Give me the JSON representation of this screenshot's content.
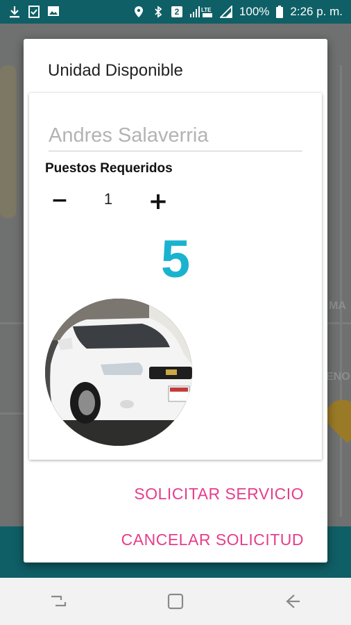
{
  "status_bar": {
    "battery": "100%",
    "time": "2:26 p. m.",
    "sim_slot": "2",
    "network": "LTE",
    "icons": [
      "download-icon",
      "checklist-icon",
      "image-icon",
      "location-icon",
      "bluetooth-icon",
      "sim-icon",
      "signal-icon",
      "battery-icon"
    ]
  },
  "map": {
    "labels": [
      "MA",
      "ENO"
    ]
  },
  "dialog": {
    "title": "Unidad Disponible",
    "driver_name": "Andres Salaverria",
    "seats_label": "Puestos Requeridos",
    "seats_value": "1",
    "minus_symbol": "−",
    "plus_symbol": "+",
    "available_number": "5",
    "request_button": "SOLICITAR SERVICIO",
    "cancel_button": "CANCELAR SOLICITUD"
  },
  "colors": {
    "accent": "#1ab3cf",
    "button_text": "#e53d8b",
    "brand_dark": "#0f5f66"
  },
  "nav_bar": {
    "icons": [
      "recent-apps-icon",
      "home-icon",
      "back-icon"
    ]
  }
}
